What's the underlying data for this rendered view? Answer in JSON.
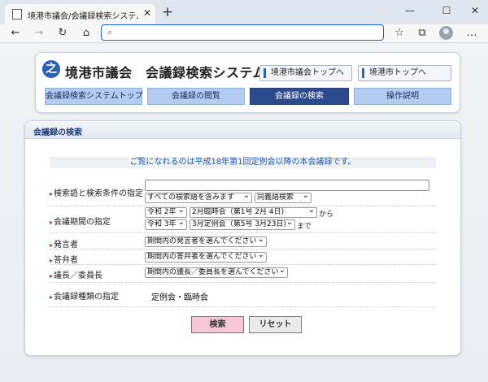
{
  "browser": {
    "tab_title": "境港市議会/会議録検索システム",
    "tab_close": "✕",
    "new_tab": "+",
    "window_controls": {
      "minimize": "—",
      "maximize": "☐",
      "close": "✕"
    },
    "nav_icons": {
      "back": "←",
      "forward": "→",
      "refresh": "↻",
      "home": "⌂",
      "favorites": "☆",
      "collections": "⧉",
      "more": "…"
    },
    "address_placeholder": "",
    "search_icon": "🔍"
  },
  "header": {
    "logo_glyph": "之",
    "site_title": "境港市議会　会議録検索システム",
    "links": [
      {
        "label": "境港市議会トップへ"
      },
      {
        "label": "境港市トップへ"
      }
    ],
    "tabs": [
      {
        "label": "会議録検索システムトップ",
        "active": false
      },
      {
        "label": "会議録の閲覧",
        "active": false
      },
      {
        "label": "会議録の検索",
        "active": true
      },
      {
        "label": "操作説明",
        "active": false
      }
    ]
  },
  "search_panel": {
    "title": "会議録の検索",
    "notice": "ご覧になれるのは平成18年第1回定例会以降の本会議録です。",
    "keyword": {
      "label": "検索語と検索条件の指定",
      "input_value": "",
      "match_mode": "すべての検索語を含みます",
      "search_type": "同義語検索"
    },
    "period": {
      "label": "会議期間の指定",
      "from_era": "令和 2年",
      "from_session": "2月臨時会（第1号 2月 4日)",
      "from_suffix": "から",
      "to_era": "令和 3年",
      "to_session": "3月定例会（第5号 3月23日)",
      "to_suffix": "まで"
    },
    "speaker": {
      "label": "発言者",
      "select": "期間内の発言者を選んでください"
    },
    "answerer": {
      "label": "答弁者",
      "select": "期間内の答弁者を選んでください"
    },
    "chair": {
      "label": "議長／委員長",
      "select": "期間内の議長／委員長を選んでください"
    },
    "record_type": {
      "label": "会議録種類の指定",
      "value": "定例会・臨時会"
    },
    "buttons": {
      "search": "検索",
      "reset": "リセット"
    }
  }
}
